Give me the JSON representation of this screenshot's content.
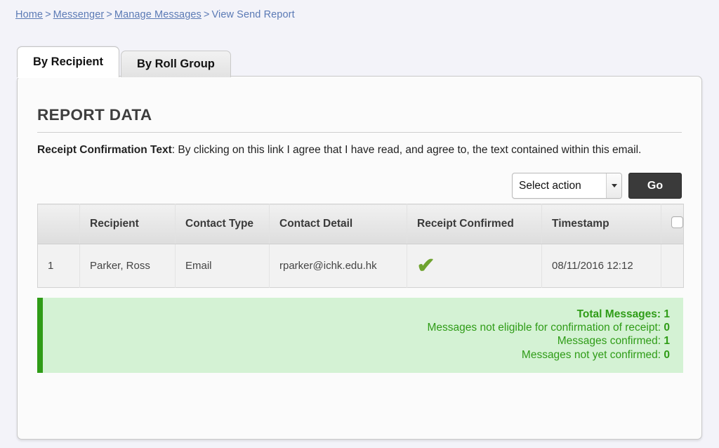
{
  "breadcrumb": {
    "items": [
      {
        "label": "Home",
        "link": true
      },
      {
        "label": "Messenger",
        "link": true
      },
      {
        "label": "Manage Messages",
        "link": true
      },
      {
        "label": "View Send Report",
        "link": false
      }
    ],
    "separator": ">"
  },
  "tabs": [
    {
      "label": "By Recipient",
      "active": true
    },
    {
      "label": "By Roll Group",
      "active": false
    }
  ],
  "main": {
    "section_title": "REPORT DATA",
    "receipt_label": "Receipt Confirmation Text",
    "receipt_body": ": By clicking on this link I agree that I have read, and agree to, the text contained within this email."
  },
  "actionbar": {
    "select_value": "Select action",
    "go_label": "Go"
  },
  "table": {
    "headers": [
      "Recipient",
      "Contact Type",
      "Contact Detail",
      "Receipt Confirmed",
      "Timestamp"
    ],
    "rows": [
      {
        "index": "1",
        "recipient": "Parker, Ross",
        "contact_type": "Email",
        "contact_detail": "rparker@ichk.edu.hk",
        "receipt_confirmed": "✔",
        "timestamp": "08/11/2016 12:12"
      }
    ]
  },
  "summary": {
    "lines": [
      {
        "label": "Total Messages:",
        "value": "1"
      },
      {
        "label": "Messages not eligible for confirmation of receipt:",
        "value": "0"
      },
      {
        "label": "Messages confirmed:",
        "value": "1"
      },
      {
        "label": "Messages not yet confirmed:",
        "value": "0"
      }
    ]
  },
  "colors": {
    "link": "#5b7ab5",
    "accent_green": "#2f9c17",
    "summary_bg": "#d4f2d4",
    "go_button": "#3a3a3a",
    "check": "#6fa32f"
  }
}
